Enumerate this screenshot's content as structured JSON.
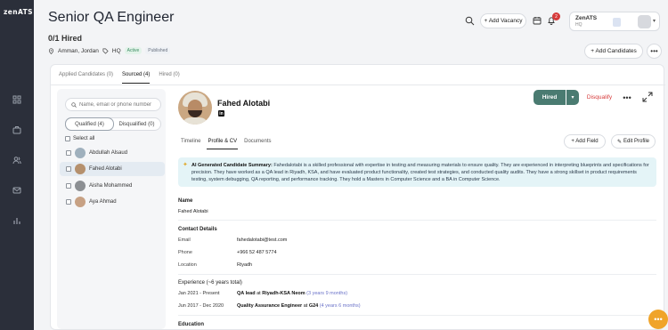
{
  "app": {
    "logo": "zenATS"
  },
  "header": {
    "title": "Senior QA Engineer",
    "hired_count": "0/1 Hired",
    "location": "Amman, Jordan",
    "hq_label": "HQ",
    "status_active": "Active",
    "status_published": "Published",
    "add_vacancy": "+ Add Vacancy",
    "notification_count": "2",
    "company_name": "ZenATS",
    "company_sub": "HQ",
    "add_candidates": "+ Add Candidates",
    "more": "•••"
  },
  "pipeline_tabs": [
    {
      "label": "Applied Candidates (0)"
    },
    {
      "label": "Sourced (4)"
    },
    {
      "label": "Hired (0)"
    }
  ],
  "list": {
    "search_placeholder": "Name, email or phone number",
    "qualified": "Qualified (4)",
    "disqualified": "Disqualified (0)",
    "select_all": "Select all",
    "candidates": [
      {
        "name": "Abdullah Alsaud"
      },
      {
        "name": "Fahed Alotabi"
      },
      {
        "name": "Aisha Mohammed"
      },
      {
        "name": "Aya Ahmad"
      }
    ]
  },
  "profile": {
    "name": "Fahed Alotabi",
    "linkedin": "in",
    "hired_button": "Hired",
    "disqualify": "Disqualify",
    "more": "•••",
    "tabs": [
      {
        "label": "Timeline"
      },
      {
        "label": "Profile & CV"
      },
      {
        "label": "Documents"
      }
    ],
    "add_field": "+ Add Field",
    "edit_profile": "Edit Profile",
    "ai_title": "AI Generated Candidate Summary:",
    "ai_text": "Fahedalotabi is a skilled professional with expertise in testing and measuring materials to ensure quality. They are experienced in interpreting blueprints and specifications for precision. They have worked as a QA lead in Riyadh, KSA, and have evaluated product functionality, created test strategies, and conducted quality audits. They have a strong skillset in product requirements testing, system debugging, QA reporting, and performance tracking. They hold a Masters in Computer Science and a BA in Computer Science.",
    "name_label": "Name",
    "name_value": "Fahed Alotabi",
    "contact_label": "Contact Details",
    "email_label": "Email",
    "email_value": "fahedalotabi@test.com",
    "phone_label": "Phone",
    "phone_value": "+966 52 487 5774",
    "location_label": "Location",
    "location_value": "Riyadh",
    "experience_label": "Experience (~6 years total)",
    "experience": [
      {
        "dates": "Jan 2021 - Present",
        "role": "QA lead",
        "at": "at",
        "company": "Riyadh-KSA Neom",
        "duration": "(3 years 9 months)"
      },
      {
        "dates": "Jun 2017 - Dec 2020",
        "role": "Quality Assurance Engineer",
        "at": "at",
        "company": "G24",
        "duration": "(4 years 6 months)"
      }
    ],
    "education_label": "Education"
  },
  "colors": {
    "sidebar": "#2b2f3a",
    "hired_button": "#4a7b71",
    "disqualify": "#d63a3a",
    "ai_box": "#e4f4f7",
    "fab": "#f0a42a"
  }
}
